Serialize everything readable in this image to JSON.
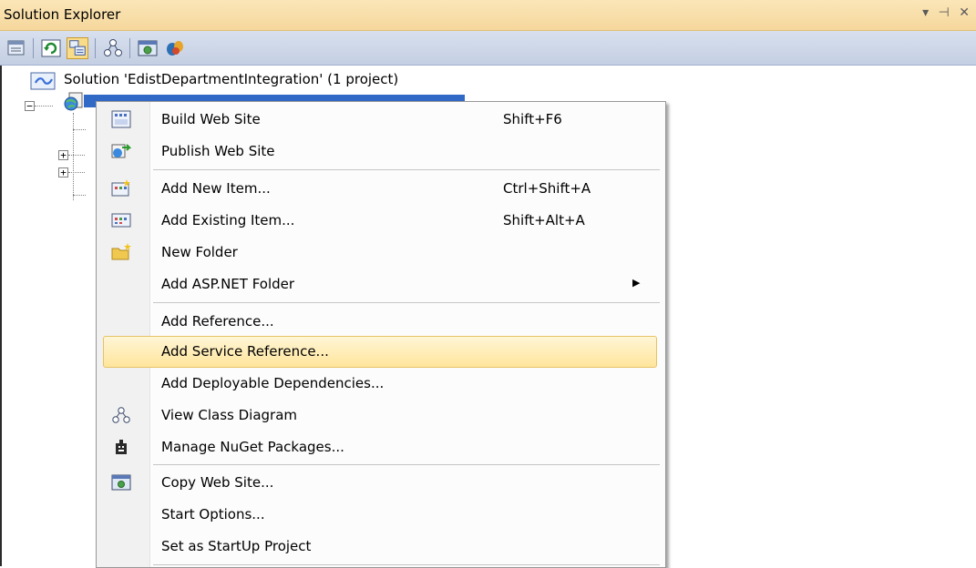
{
  "panel": {
    "title": "Solution Explorer",
    "controls": "▾ ⊣ ✕"
  },
  "toolbar": {
    "buttons": [
      {
        "icon": "properties-icon"
      },
      {
        "icon": "refresh-icon"
      },
      {
        "icon": "show-all-files-icon"
      },
      {
        "icon": "class-diagram-icon"
      },
      {
        "icon": "copy-web-site-icon"
      },
      {
        "icon": "nuget-icon"
      }
    ]
  },
  "tree": {
    "solution_label": "Solution 'EdistDepartmentIntegration' (1 project)"
  },
  "menu": {
    "items": [
      {
        "label": "Build Web Site",
        "shortcut": "Shift+F6",
        "icon": "build-icon"
      },
      {
        "label": "Publish Web Site",
        "shortcut": "",
        "icon": "publish-icon"
      },
      {
        "label": "Add New Item...",
        "shortcut": "Ctrl+Shift+A",
        "icon": "new-item-icon"
      },
      {
        "label": "Add Existing Item...",
        "shortcut": "Shift+Alt+A",
        "icon": "existing-item-icon"
      },
      {
        "label": "New Folder",
        "shortcut": "",
        "icon": "new-folder-icon"
      },
      {
        "label": "Add ASP.NET Folder",
        "shortcut": "",
        "submenu": true
      },
      {
        "label": "Add Reference...",
        "shortcut": ""
      },
      {
        "label": "Add Service Reference...",
        "shortcut": "",
        "highlighted": true
      },
      {
        "label": "Add Deployable Dependencies...",
        "shortcut": ""
      },
      {
        "label": "View Class Diagram",
        "shortcut": "",
        "icon": "class-diagram-icon"
      },
      {
        "label": "Manage NuGet Packages...",
        "shortcut": "",
        "icon": "nuget-package-icon"
      },
      {
        "label": "Copy Web Site...",
        "shortcut": "",
        "icon": "copy-web-site-icon"
      },
      {
        "label": "Start Options...",
        "shortcut": ""
      },
      {
        "label": "Set as StartUp Project",
        "shortcut": ""
      }
    ]
  },
  "colors": {
    "selection": "#3169c6",
    "highlight": "#ffe59c",
    "title_bar": "#f5d79c",
    "toolbar": "#c4cfe3"
  }
}
